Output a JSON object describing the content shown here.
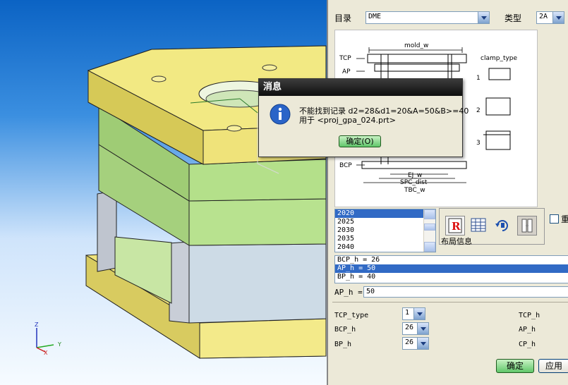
{
  "viewport": {
    "axis_labels": {
      "z": "Z",
      "y": "Y",
      "x": "X"
    }
  },
  "panel": {
    "catalog_label": "目录",
    "catalog_value": "DME",
    "type_label": "类型",
    "type_value": "2A",
    "diagram": {
      "labels": [
        "mold_w",
        "TCP",
        "AP",
        "BCP",
        "EJ_w",
        "SPC_dist",
        "TBC_w",
        "clamp_type",
        "1",
        "2",
        "3"
      ]
    },
    "size_list": {
      "items": [
        "2020",
        "2025",
        "2030",
        "2035",
        "2040"
      ],
      "selected_index": 0
    },
    "toolbar": {
      "icons": [
        "red-r-icon",
        "table-icon",
        "rotate-icon",
        "mold-icon"
      ],
      "caption": "布局信息"
    },
    "reuse_checkbox_label": "重",
    "param_list": {
      "items": [
        "BCP_h = 26",
        "AP_h = 50",
        "BP_h = 40"
      ],
      "selected_index": 1
    },
    "edit": {
      "label": "AP_h =",
      "value": "50"
    },
    "fields": [
      {
        "label": "TCP_type",
        "value": "1"
      },
      {
        "label": "BCP_h",
        "value": "26"
      },
      {
        "label": "BP_h",
        "value": "26"
      }
    ],
    "right_labels": [
      "TCP_h",
      "AP_h",
      "CP_h"
    ],
    "ok_label": "确定",
    "apply_label": "应用"
  },
  "dialog": {
    "title": "消息",
    "line1": "不能找到记录  d2=28&d1=20&A=50&B>=40",
    "line2": "用于 <proj_gpa_024.prt>",
    "ok_label": "确定(O)"
  },
  "colors": {
    "plate_yellow": "#f0e67a",
    "plate_green": "#b4e08a",
    "selection_blue": "#316ac5",
    "dialog_title": "#1a1a1a"
  }
}
